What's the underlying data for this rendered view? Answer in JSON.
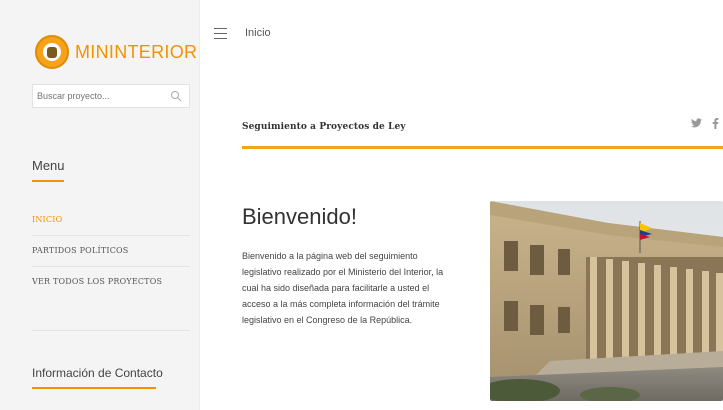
{
  "brand": {
    "name": "MININTERIOR"
  },
  "search": {
    "placeholder": "Buscar proyecto..."
  },
  "sidebar": {
    "menu_heading": "Menu",
    "items": [
      {
        "label": "INICIO",
        "active": true
      },
      {
        "label": "PARTIDOS POLÍTICOS",
        "active": false
      },
      {
        "label": "VER TODOS LOS PROYECTOS",
        "active": false
      }
    ],
    "contact_heading": "Información de Contacto"
  },
  "header": {
    "breadcrumb": "Inicio"
  },
  "section": {
    "title": "Seguimiento a Proyectos de Ley"
  },
  "social": {
    "twitter": "𝕥",
    "facebook": "f"
  },
  "welcome": {
    "title": "Bienvenido!",
    "text": "Bienvenido a la página web del seguimiento legislativo realizado por el Ministerio del Interior, la cual ha sido diseñada para facilitarle a usted el acceso a la más completa información del trámite legislativo en el Congreso de la República."
  },
  "colors": {
    "accent": "#f39200",
    "sidebar_bg": "#f4f4f4"
  },
  "icons": {
    "menu": "hamburger-icon",
    "search": "search-icon",
    "twitter": "twitter-icon",
    "facebook": "facebook-icon"
  }
}
